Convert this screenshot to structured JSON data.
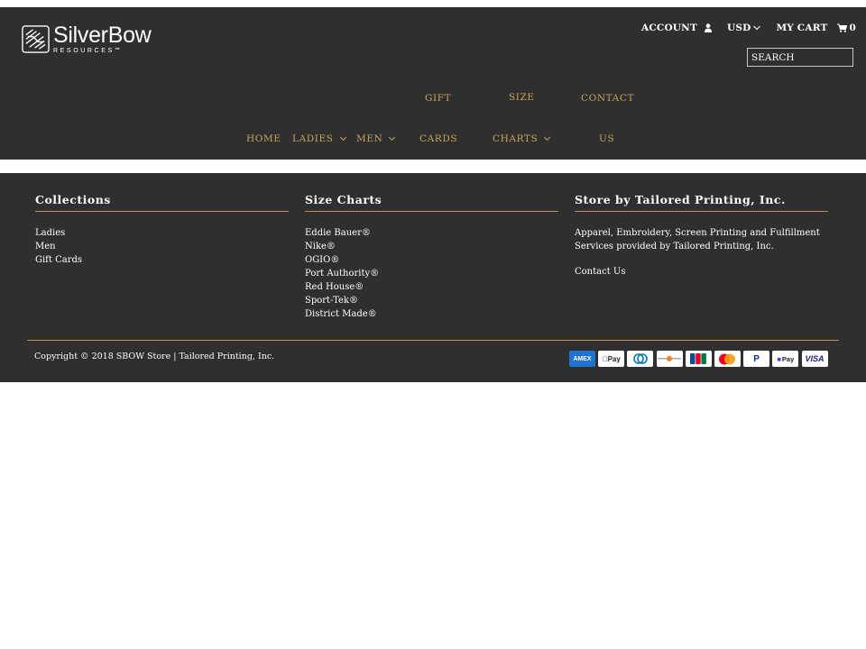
{
  "brand": {
    "name": "SilverBow",
    "sub": "RESOURCES℠"
  },
  "util": {
    "account": "ACCOUNT",
    "currency": "USD",
    "cart": "MY CART",
    "cart_count": "0"
  },
  "search": {
    "placeholder": "SEARCH"
  },
  "nav": {
    "home": "HOME",
    "ladies": "LADIES",
    "men": "MEN",
    "gift_line1": "GIFT",
    "gift_line2": "CARDS",
    "size_line1": "SIZE",
    "size_line2": "CHARTS",
    "contact_line1": "CONTACT",
    "contact_line2": "US"
  },
  "footer": {
    "collections": {
      "heading": "Collections",
      "links": [
        "Ladies",
        "Men",
        "Gift Cards"
      ]
    },
    "size_charts": {
      "heading": "Size Charts",
      "links": [
        "Eddie Bauer®",
        "Nike®",
        "OGIO®",
        "Port Authority®",
        "Red House®",
        "Sport-Tek®",
        "District Made®"
      ]
    },
    "store": {
      "heading": "Store by Tailored Printing, Inc.",
      "text": "Apparel, Embroidery, Screen Printing and Fulfillment Services provided by Tailored Printing, Inc.",
      "contact": "Contact Us"
    },
    "copyright": "Copyright © 2018 SBOW Store | Tailored Printing, Inc."
  },
  "payments": [
    "American Express",
    "Apple Pay",
    "Diners Club",
    "Discover",
    "JCB",
    "Mastercard",
    "PayPal",
    "Shopify Pay",
    "Visa"
  ],
  "colors": {
    "header_bg": "#2f2f2f",
    "nav_gold": "#c9a45a",
    "rule": "#b88e4e"
  }
}
